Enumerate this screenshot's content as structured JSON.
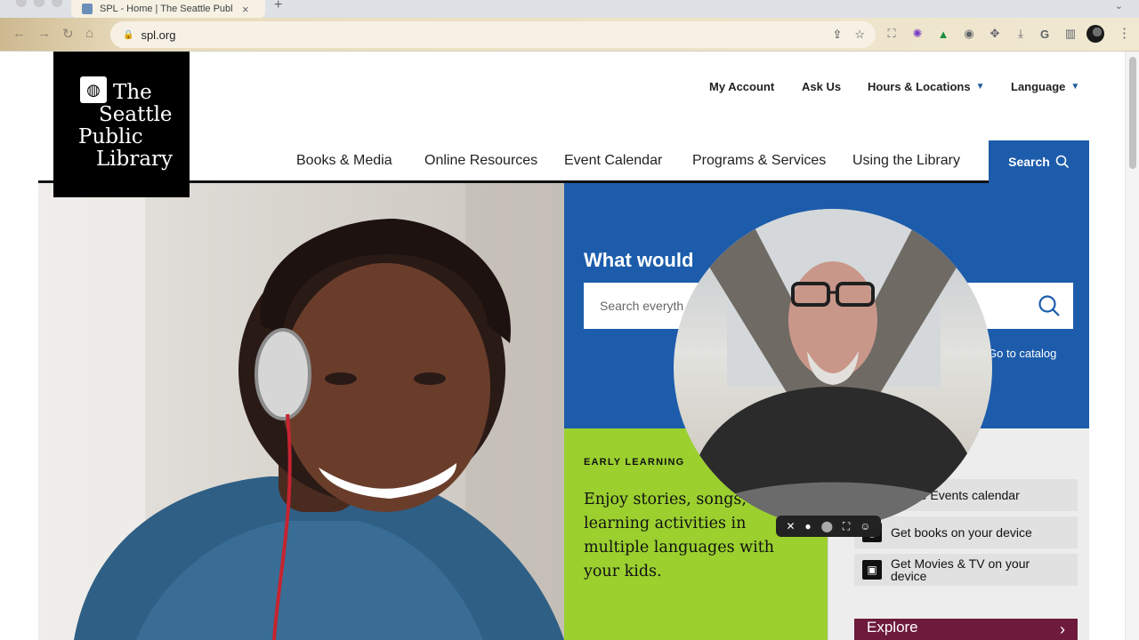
{
  "browser": {
    "tab_title": "SPL - Home | The Seattle Public Library",
    "tab_close": "×",
    "new_tab": "+",
    "url": "spl.org"
  },
  "logo": {
    "line1": "The",
    "line2": "Seattle",
    "line3": "Public",
    "line4": "Library"
  },
  "utility_nav": {
    "my_account": "My Account",
    "ask_us": "Ask Us",
    "hours_locations": "Hours & Locations",
    "language": "Language"
  },
  "main_nav": {
    "books_media": "Books & Media",
    "online_resources": "Online Resources",
    "event_calendar": "Event Calendar",
    "programs_services": "Programs & Services",
    "using_library": "Using the Library",
    "search": "Search"
  },
  "search_panel": {
    "heading": "What would",
    "placeholder": "Search everyth",
    "catalog_link": "Go to catalog"
  },
  "early_learning": {
    "label": "EARLY LEARNING",
    "text": "Enjoy stories, songs, a learning activities in multiple languages with your kids."
  },
  "quick_links": [
    {
      "label": "Online Events calendar"
    },
    {
      "label": "Get books on your device"
    },
    {
      "label": "Get Movies & TV on your device"
    }
  ],
  "explore": {
    "label": "Explore"
  },
  "colors": {
    "brand_blue": "#1c5cab",
    "early_green": "#9bd02f",
    "explore_maroon": "#6d1a3c"
  }
}
